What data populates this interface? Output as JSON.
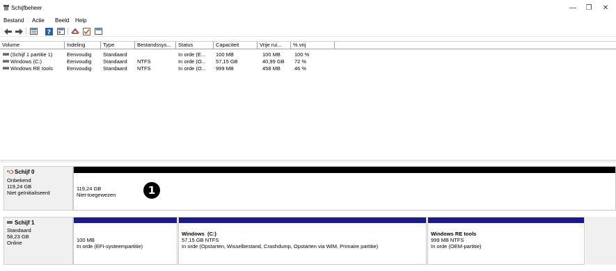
{
  "window": {
    "title": "Schijfbeheer",
    "controls": {
      "minimize": "—",
      "maximize": "❐",
      "close": "✕"
    }
  },
  "menu": [
    "Bestand",
    "Actie",
    "Beeld",
    "Help"
  ],
  "toolbar": {
    "icons": [
      "back-arrow-icon",
      "forward-arrow-icon",
      "disk-list-icon",
      "help-icon",
      "properties-icon",
      "connect-icon",
      "check-icon",
      "refresh-view-icon"
    ]
  },
  "volume_table": {
    "headers": [
      "Volume",
      "Indeling",
      "Type",
      "Bestandssys...",
      "Status",
      "Capaciteit",
      "Vrije rui...",
      "% vrij"
    ],
    "rows": [
      [
        "(Schijf 1 partitie 1)",
        "Eenvoudig",
        "Standaard",
        "",
        "In orde (E...",
        "100 MB",
        "100 MB",
        "100 %"
      ],
      [
        "Windows (C:)",
        "Eenvoudig",
        "Standaard",
        "NTFS",
        "In orde (O...",
        "57,15 GB",
        "40,99 GB",
        "72 %"
      ],
      [
        "Windows RE tools",
        "Eenvoudig",
        "Standaard",
        "NTFS",
        "In orde (O...",
        "999 MB",
        "458 MB",
        "46 %"
      ]
    ]
  },
  "disks": [
    {
      "name": "Schijf 0",
      "type": "Onbekend",
      "size": "119,24 GB",
      "status": "Niet geïnitialiseerd",
      "partitions": [
        {
          "label": "",
          "size": "119,24 GB",
          "status": "Niet-toegewezen",
          "bar_color": "#000000"
        }
      ]
    },
    {
      "name": "Schijf 1",
      "type": "Standaard",
      "size": "58,23 GB",
      "status": "Online",
      "partitions": [
        {
          "label": "",
          "size": "100 MB",
          "status": "In orde (EFI-systeempartitie)",
          "bar_color": "#1a1a8c"
        },
        {
          "label": "Windows  (C:)",
          "size": "57,15 GB NTFS",
          "status": "In orde (Opstarten, Wisselbestand, Crashdump, Opstarten via WIM, Primaire partitie)",
          "bar_color": "#1a1a8c"
        },
        {
          "label": "Windows RE tools",
          "size": "999 MB NTFS",
          "status": "In orde (OEM-partitie)",
          "bar_color": "#1a1a8c"
        }
      ]
    }
  ],
  "callout": "1"
}
